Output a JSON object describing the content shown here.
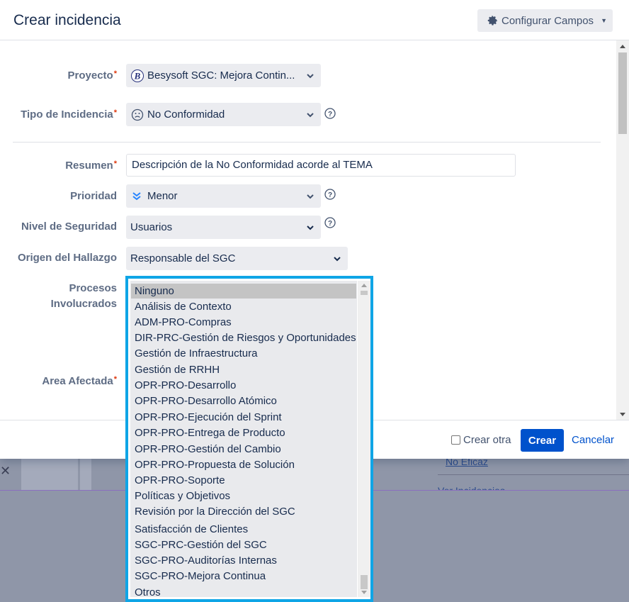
{
  "background": {
    "link1": "No Eficaz",
    "link2": "Ver Incidencias"
  },
  "modal": {
    "title": "Crear incidencia",
    "config_button": "Configurar Campos",
    "fields": {
      "proyecto": {
        "label": "Proyecto",
        "value": "Besysoft SGC: Mejora Contin..."
      },
      "tipo": {
        "label": "Tipo de Incidencia",
        "value": "No Conformidad"
      },
      "resumen": {
        "label": "Resumen",
        "value": "Descripción de la No Conformidad acorde al TEMA"
      },
      "prioridad": {
        "label": "Prioridad",
        "value": "Menor"
      },
      "seguridad": {
        "label": "Nivel de Seguridad",
        "value": "Usuarios"
      },
      "origen": {
        "label": "Origen del Hallazgo",
        "value": "Responsable del SGC"
      },
      "procesos": {
        "label_line1": "Procesos",
        "label_line2": "Involucrados"
      },
      "area": {
        "label": "Area Afectada"
      }
    },
    "required_mark": "*",
    "footer": {
      "create_another": "Crear otra",
      "create": "Crear",
      "cancel": "Cancelar"
    }
  },
  "process_options": [
    "Ninguno",
    "Análisis de Contexto",
    "ADM-PRO-Compras",
    "DIR-PRC-Gestión de Riesgos y Oportunidades",
    "Gestión de Infraestructura",
    "Gestión de RRHH",
    "OPR-PRO-Desarrollo",
    "OPR-PRO-Desarrollo Atómico",
    "OPR-PRO-Ejecución del Sprint",
    "OPR-PRO-Entrega de Producto",
    "OPR-PRO-Gestión del Cambio",
    "OPR-PRO-Propuesta de Solución",
    "OPR-PRO-Soporte",
    "Políticas y Objetivos",
    "Revisión por la Dirección del SGC",
    "Satisfacción de Clientes",
    "SGC-PRC-Gestión del SGC",
    "SGC-PRO-Auditorías Internas",
    "SGC-PRO-Mejora Continua",
    "Otros"
  ],
  "selected_option": "Ninguno",
  "colors": {
    "accent": "#0052cc",
    "list_border": "#0fa5e6",
    "required": "#de350b"
  }
}
